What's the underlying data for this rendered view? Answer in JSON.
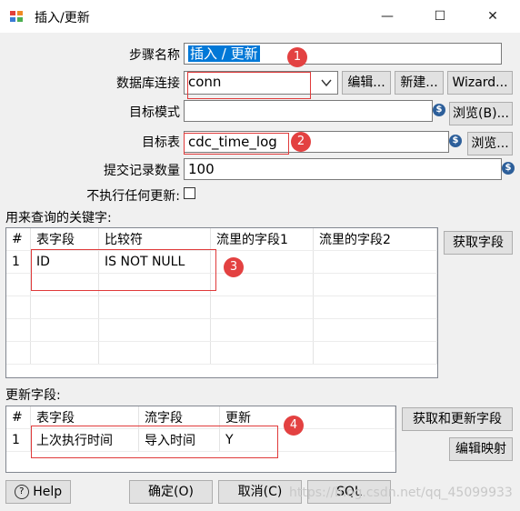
{
  "window": {
    "title": "插入/更新",
    "minimize": "—",
    "maximize": "☐",
    "close": "✕"
  },
  "form": {
    "step_name_label": "步骤名称",
    "step_name_value": "插入 / 更新",
    "connection_label": "数据库连接",
    "connection_value": "conn",
    "edit_button": "编辑...",
    "new_button": "新建...",
    "wizard_button": "Wizard...",
    "target_schema_label": "目标模式",
    "target_schema_value": "",
    "browse_schema_button": "浏览(B)...",
    "target_table_label": "目标表",
    "target_table_value": "cdc_time_log",
    "browse_table_button": "浏览...",
    "commit_size_label": "提交记录数量",
    "commit_size_value": "100",
    "no_update_label": "不执行任何更新:"
  },
  "keys": {
    "section_label": "用来查询的关键字:",
    "get_fields_button": "获取字段",
    "columns": [
      "#",
      "表字段",
      "比较符",
      "流里的字段1",
      "流里的字段2"
    ],
    "rows": [
      [
        "1",
        "ID",
        "IS NOT NULL",
        "",
        ""
      ]
    ]
  },
  "update": {
    "section_label": "更新字段:",
    "get_update_fields_button": "获取和更新字段",
    "edit_mapping_button": "编辑映射",
    "columns": [
      "#",
      "表字段",
      "流字段",
      "更新"
    ],
    "rows": [
      [
        "1",
        "上次执行时间",
        "导入时间",
        "Y"
      ]
    ]
  },
  "footer": {
    "help_button": "Help",
    "ok_button": "确定(O)",
    "cancel_button": "取消(C)",
    "sql_button": "SQL",
    "watermark": "https://blog.csdn.net/qq_45099933"
  },
  "badges": [
    "1",
    "2",
    "3",
    "4"
  ],
  "colors": {
    "annotation_red": "#e03a3a",
    "selection_blue": "#0078d7",
    "variable_icon": "#2d5f9a"
  }
}
